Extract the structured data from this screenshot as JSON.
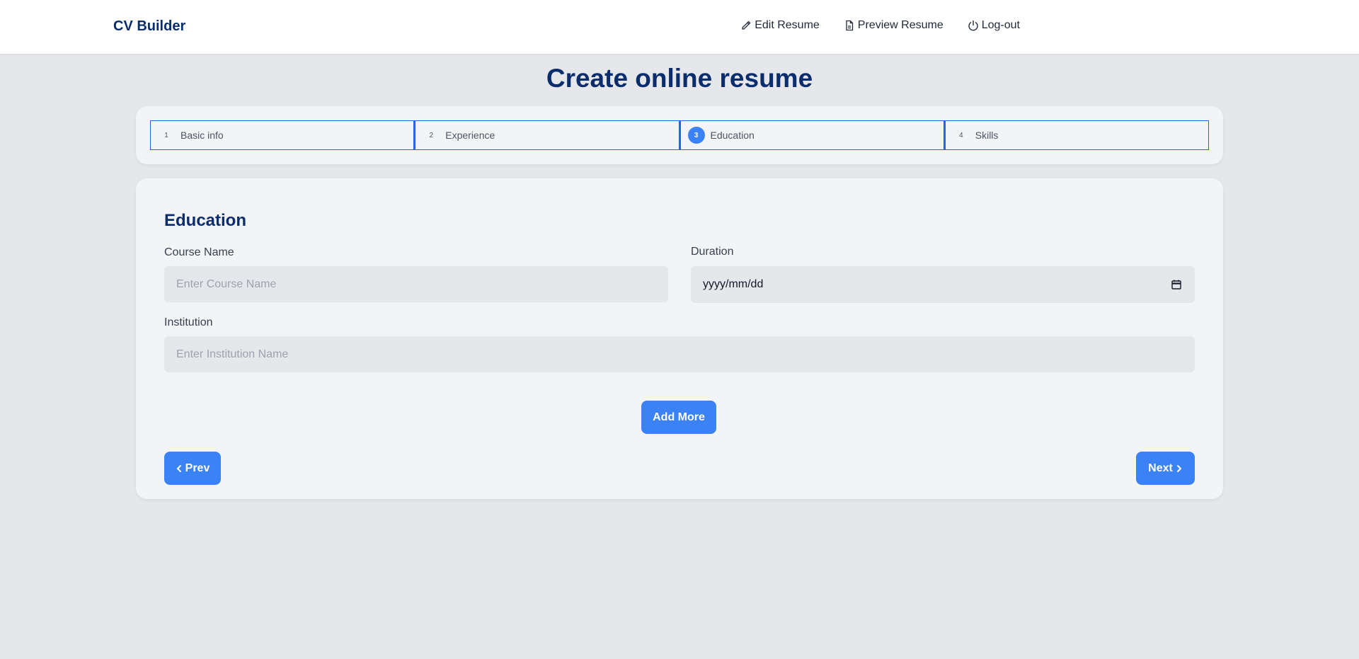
{
  "nav": {
    "brand": "CV Builder",
    "links": [
      {
        "label": "Edit Resume",
        "icon": "pencil-icon"
      },
      {
        "label": "Preview Resume",
        "icon": "file-icon"
      },
      {
        "label": "Log-out",
        "icon": "power-icon"
      }
    ]
  },
  "page": {
    "title": "Create online resume"
  },
  "stepper": {
    "active_step": 3,
    "steps": [
      {
        "num": "1",
        "label": "Basic info"
      },
      {
        "num": "2",
        "label": "Experience"
      },
      {
        "num": "3",
        "label": "Education"
      },
      {
        "num": "4",
        "label": "Skills"
      }
    ]
  },
  "form": {
    "section_title": "Education",
    "course": {
      "label": "Course Name",
      "placeholder": "Enter Course Name",
      "value": ""
    },
    "duration": {
      "label": "Duration",
      "value": "yyyy/mm/dd",
      "icon": "calendar-icon"
    },
    "institution": {
      "label": "Institution",
      "placeholder": "Enter Institution Name",
      "value": ""
    },
    "add_more_label": "Add More",
    "prev_label": "Prev",
    "next_label": "Next"
  },
  "colors": {
    "accent": "#3b82f6",
    "heading": "#0b2d6b",
    "background": "#e5e7eb",
    "card": "#f3f4f6"
  }
}
